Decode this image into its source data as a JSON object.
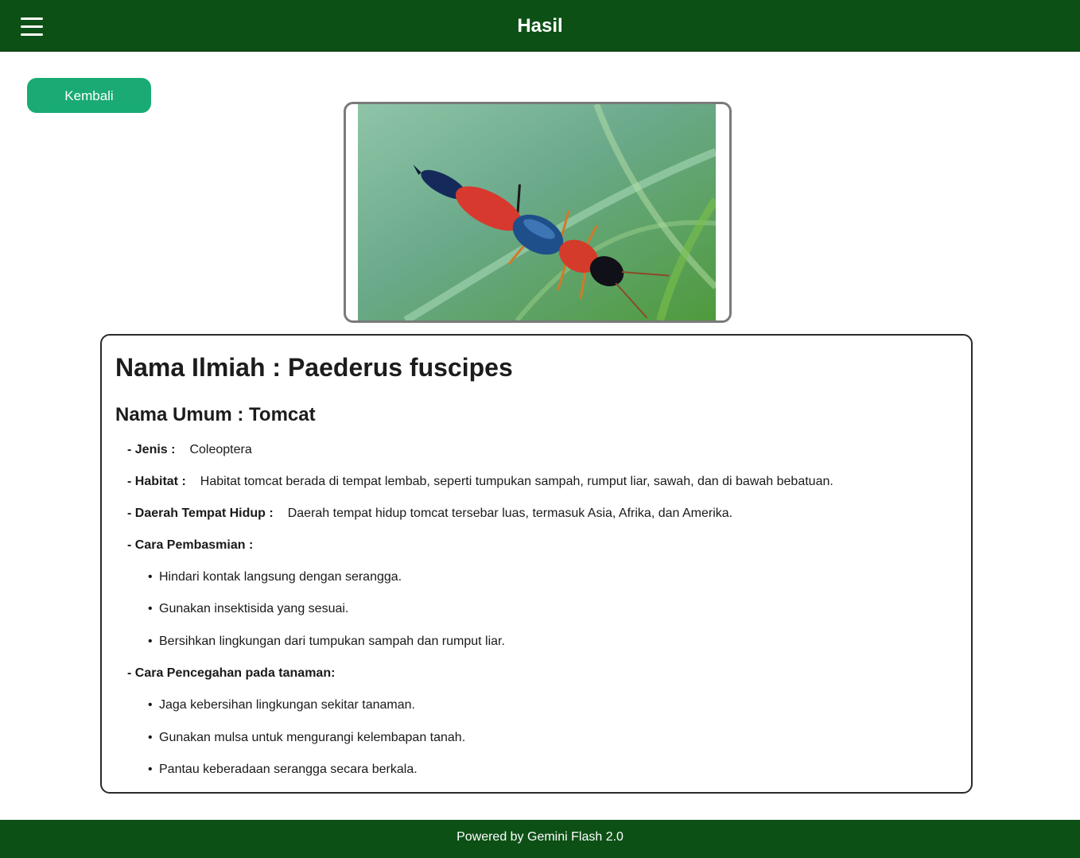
{
  "header": {
    "title": "Hasil",
    "menu_icon": "hamburger-menu-icon"
  },
  "back_button": {
    "label": "Kembali"
  },
  "result": {
    "scientific_name": "Nama Ilmiah : Paederus fuscipes",
    "common_name": "Nama Umum : Tomcat",
    "type": {
      "label": "- Jenis :",
      "value": "Coleoptera"
    },
    "habitat": {
      "label": "- Habitat :",
      "value": "Habitat tomcat berada di tempat lembab, seperti tumpukan sampah, rumput liar, sawah, dan di bawah bebatuan."
    },
    "living_area": {
      "label": "- Daerah Tempat Hidup :",
      "value": "Daerah tempat hidup tomcat tersebar luas, termasuk Asia, Afrika, dan Amerika."
    },
    "eradication": {
      "label": "- Cara Pembasmian :",
      "items": [
        "Hindari kontak langsung dengan serangga.",
        "Gunakan insektisida yang sesuai.",
        "Bersihkan lingkungan dari tumpukan sampah dan rumput liar."
      ]
    },
    "prevention": {
      "label": "- Cara Pencegahan pada tanaman:",
      "items": [
        "Jaga kebersihan lingkungan sekitar tanaman.",
        "Gunakan mulsa untuk mengurangi kelembapan tanah.",
        "Pantau keberadaan serangga secara berkala."
      ]
    }
  },
  "footer": {
    "text": "Powered by Gemini Flash 2.0"
  },
  "colors": {
    "header_bg": "#0d5016",
    "button_bg": "#19ab73",
    "text": "#1a1a1a"
  }
}
